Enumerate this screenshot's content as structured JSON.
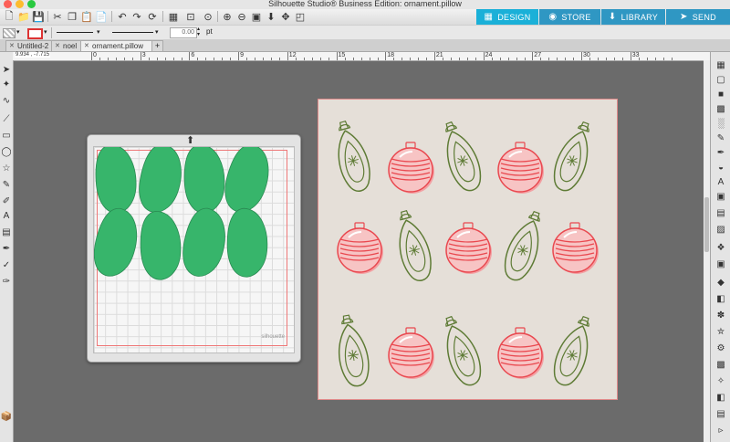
{
  "window": {
    "title": "Silhouette Studio® Business Edition: ornament.pillow"
  },
  "panel_tabs": [
    {
      "label": "DESIGN",
      "color": "#1ab0d8"
    },
    {
      "label": "STORE",
      "color": "#2f97c3"
    },
    {
      "label": "LIBRARY",
      "color": "#2f97c3"
    },
    {
      "label": "SEND",
      "color": "#2f97c3"
    }
  ],
  "props": {
    "line_width": "0.00",
    "unit": "pt"
  },
  "doc_tabs": [
    "Untitled-2",
    "noel",
    "ornament.pillow"
  ],
  "active_tab": 2,
  "ruler": {
    "labels": [
      "0",
      "3",
      "6",
      "9",
      "12",
      "15",
      "18",
      "21",
      "24",
      "27",
      "30",
      "33"
    ]
  },
  "coordinates": "9.934 , -7.715",
  "mat": {
    "logo": "silhouette"
  },
  "colors": {
    "leaf": "#37b56b",
    "ornament_red": "#e9484f",
    "ornament_green": "#5e7b35",
    "accent": "#1ab0d8"
  }
}
